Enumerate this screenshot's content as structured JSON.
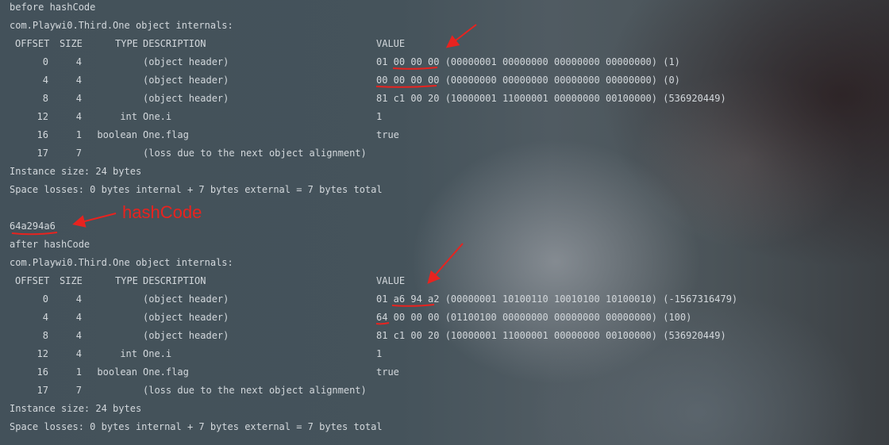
{
  "before": {
    "title": "before hashCode",
    "class_line": "com.Playwi0.Third.One object internals:",
    "header": {
      "offset": "OFFSET",
      "size": "SIZE",
      "type": "TYPE",
      "description": "DESCRIPTION",
      "value": "VALUE"
    },
    "rows": [
      {
        "offset": "0",
        "size": "4",
        "type": "",
        "description": "(object header)",
        "value": "01 00 00 00 (00000001 00000000 00000000 00000000) (1)"
      },
      {
        "offset": "4",
        "size": "4",
        "type": "",
        "description": "(object header)",
        "value": "00 00 00 00 (00000000 00000000 00000000 00000000) (0)"
      },
      {
        "offset": "8",
        "size": "4",
        "type": "",
        "description": "(object header)",
        "value": "81 c1 00 20 (10000001 11000001 00000000 00100000) (536920449)"
      },
      {
        "offset": "12",
        "size": "4",
        "type": "int",
        "description": "One.i",
        "value": "1"
      },
      {
        "offset": "16",
        "size": "1",
        "type": "boolean",
        "description": "One.flag",
        "value": "true"
      },
      {
        "offset": "17",
        "size": "7",
        "type": "",
        "description": "(loss due to the next object alignment)",
        "value": ""
      }
    ],
    "instance_size": "Instance size: 24 bytes",
    "space_losses": "Space losses: 0 bytes internal + 7 bytes external = 7 bytes total"
  },
  "hash_value": "64a294a6",
  "hash_annotation": "hashCode",
  "after": {
    "title": "after hashCode",
    "class_line": "com.Playwi0.Third.One object internals:",
    "header": {
      "offset": "OFFSET",
      "size": "SIZE",
      "type": "TYPE",
      "description": "DESCRIPTION",
      "value": "VALUE"
    },
    "rows": [
      {
        "offset": "0",
        "size": "4",
        "type": "",
        "description": "(object header)",
        "value": "01 a6 94 a2 (00000001 10100110 10010100 10100010) (-1567316479)"
      },
      {
        "offset": "4",
        "size": "4",
        "type": "",
        "description": "(object header)",
        "value": "64 00 00 00 (01100100 00000000 00000000 00000000) (100)"
      },
      {
        "offset": "8",
        "size": "4",
        "type": "",
        "description": "(object header)",
        "value": "81 c1 00 20 (10000001 11000001 00000000 00100000) (536920449)"
      },
      {
        "offset": "12",
        "size": "4",
        "type": "int",
        "description": "One.i",
        "value": "1"
      },
      {
        "offset": "16",
        "size": "1",
        "type": "boolean",
        "description": "One.flag",
        "value": "true"
      },
      {
        "offset": "17",
        "size": "7",
        "type": "",
        "description": "(loss due to the next object alignment)",
        "value": ""
      }
    ],
    "instance_size": "Instance size: 24 bytes",
    "space_losses": "Space losses: 0 bytes internal + 7 bytes external = 7 bytes total"
  },
  "colors": {
    "text": "#d3d8dc",
    "annotation": "#e8231f",
    "background": "#45525a"
  }
}
